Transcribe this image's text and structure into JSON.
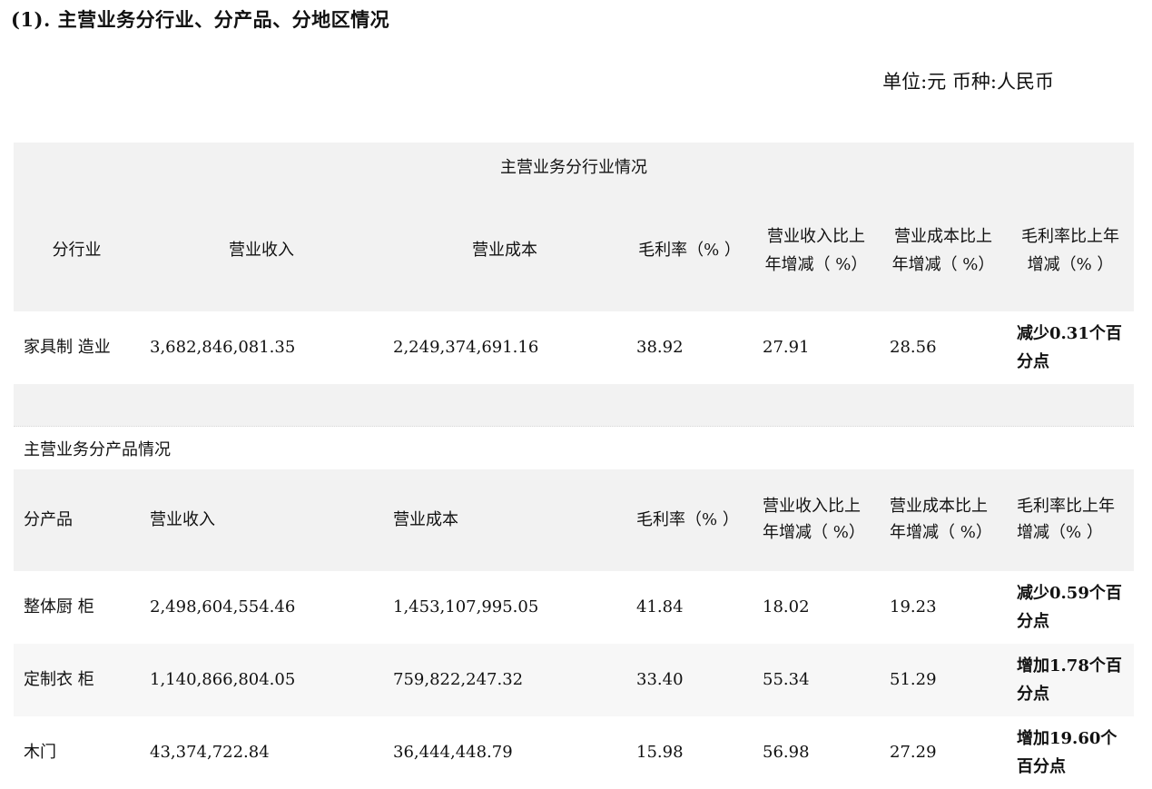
{
  "title": "(1). 主营业务分行业、分产品、分地区情况",
  "unit_label": "单位:元 币种:人民币",
  "industry_section": {
    "heading": "主营业务分行业情况",
    "columns": [
      "分行业",
      "营业收入",
      "营业成本",
      "毛利率（% ）",
      "营业收入比上年增减（ %）",
      "营业成本比上年增减（ %）",
      "毛利率比上年增减（% ）"
    ],
    "rows": [
      [
        "家具制 造业",
        "3,682,846,081.35",
        "2,249,374,691.16",
        "38.92",
        "27.91",
        "28.56",
        "减少0.31个百分点"
      ]
    ]
  },
  "product_section": {
    "heading": "主营业务分产品情况",
    "columns": [
      "分产品",
      "营业收入",
      "营业成本",
      "毛利率（% ）",
      "营业收入比上年增减（ %）",
      "营业成本比上年增减（ %）",
      "毛利率比上年增减（% ）"
    ],
    "rows": [
      [
        "整体厨 柜",
        "2,498,604,554.46",
        "1,453,107,995.05",
        "41.84",
        "18.02",
        "19.23",
        "减少0.59个百分点"
      ],
      [
        "定制衣 柜",
        "1,140,866,804.05",
        "759,822,247.32",
        "33.40",
        "55.34",
        "51.29",
        "增加1.78个百分点"
      ],
      [
        "木门",
        "43,374,722.84",
        "36,444,448.79",
        "15.98",
        "56.98",
        "27.29",
        "增加19.60个百分点"
      ]
    ]
  }
}
